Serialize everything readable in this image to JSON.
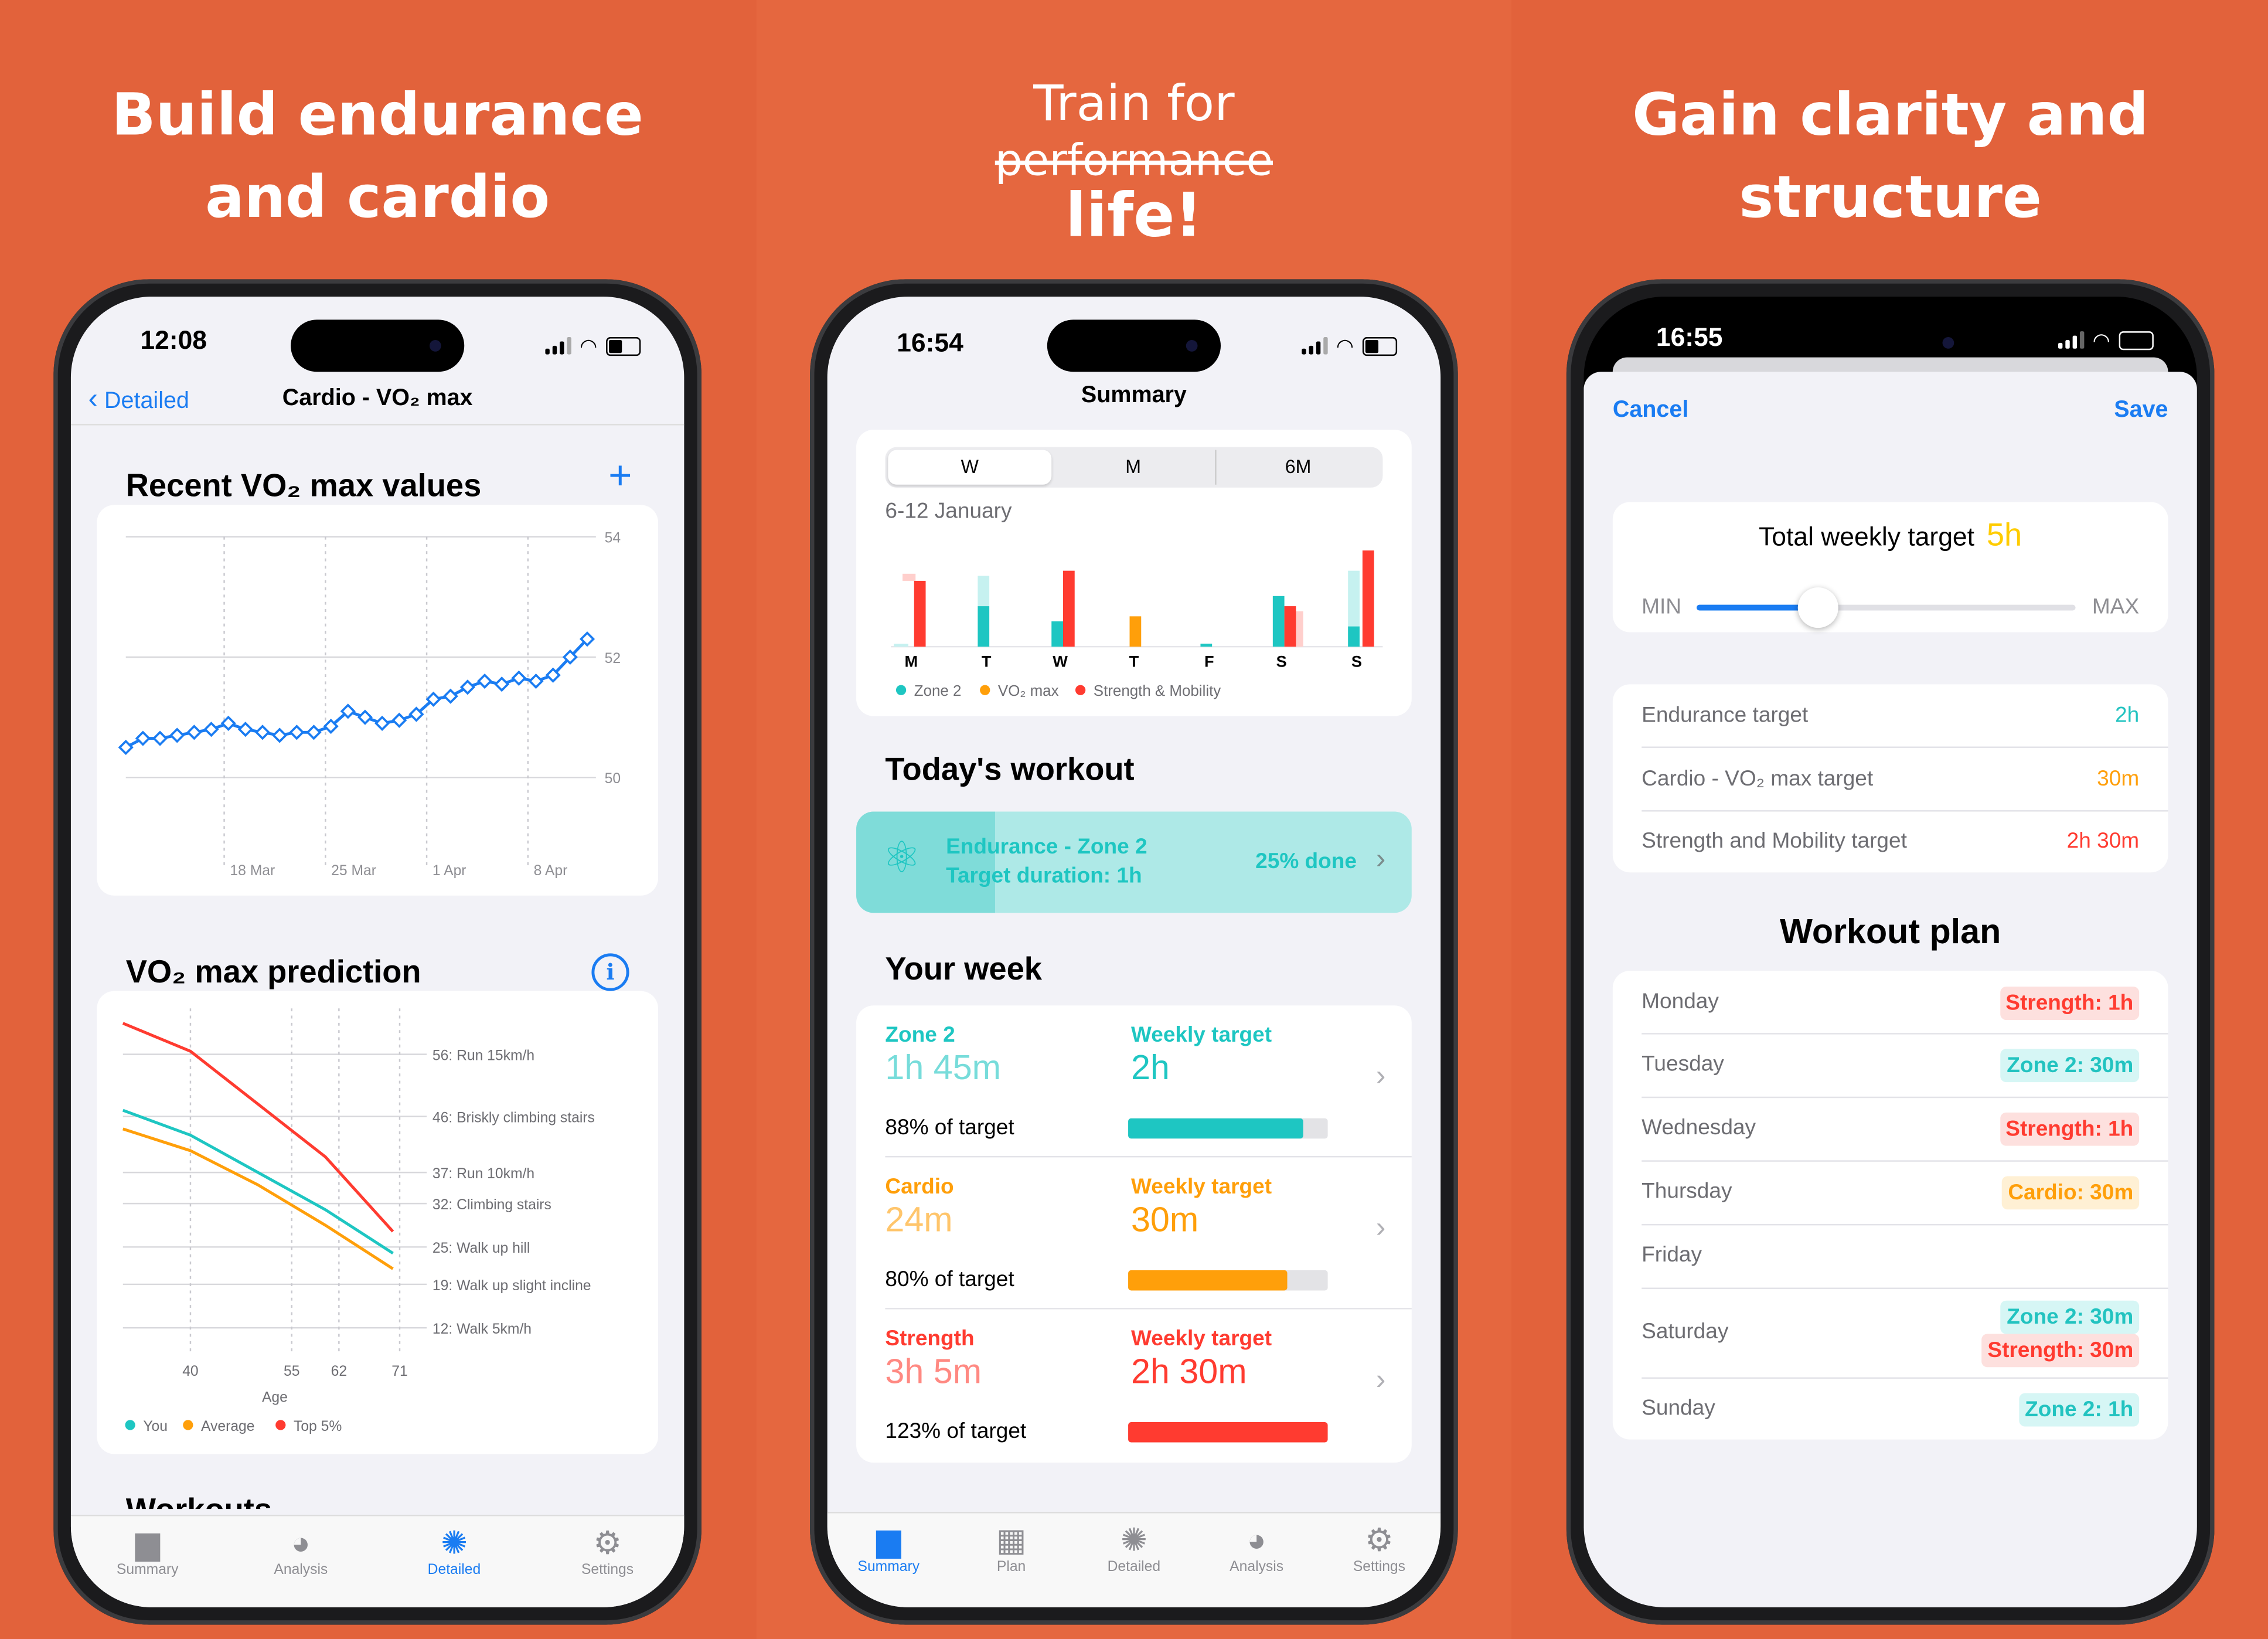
{
  "panel1": {
    "headline": [
      "Build endurance",
      "and cardio"
    ],
    "status": {
      "time": "12:08"
    },
    "nav": {
      "back": "Detailed",
      "title": "Cardio - VO₂ max"
    },
    "recent": {
      "title": "Recent VO₂ max values",
      "add": "+"
    },
    "prediction": {
      "title": "VO₂ max prediction",
      "info": "i"
    },
    "workouts_peek": "Workouts",
    "tabs": [
      "Summary",
      "Analysis",
      "Detailed",
      "Settings"
    ]
  },
  "panel2": {
    "headline": {
      "line1": "Train for",
      "struck": "performance",
      "line3": "life!"
    },
    "status": {
      "time": "16:54"
    },
    "nav_title": "Summary",
    "segments": [
      "W",
      "M",
      "6M"
    ],
    "date_range": "6-12 January",
    "todays_workout": {
      "title": "Today's workout",
      "name": "Endurance - Zone 2",
      "duration": "Target duration: 1h",
      "progress_label": "25% done",
      "progress": 0.25
    },
    "your_week": {
      "title": "Your week",
      "items": [
        {
          "name": "Zone 2",
          "value": "1h 45m",
          "target_label": "Weekly target",
          "target": "2h",
          "pct_label": "88% of target",
          "progress": 0.88,
          "color": "#1ec6c2"
        },
        {
          "name": "Cardio",
          "value": "24m",
          "target_label": "Weekly target",
          "target": "30m",
          "pct_label": "80% of target",
          "progress": 0.8,
          "color": "#ff9f0a"
        },
        {
          "name": "Strength",
          "value": "3h 5m",
          "target_label": "Weekly target",
          "target": "2h 30m",
          "pct_label": "123% of target",
          "progress": 1.0,
          "color": "#ff3b30"
        }
      ]
    },
    "tabs": [
      "Summary",
      "Plan",
      "Detailed",
      "Analysis",
      "Settings"
    ]
  },
  "panel3": {
    "headline": [
      "Gain clarity and",
      "structure"
    ],
    "status": {
      "time": "16:55"
    },
    "cancel": "Cancel",
    "save": "Save",
    "total_target": {
      "label": "Total weekly target",
      "value": "5h",
      "min": "MIN",
      "max": "MAX",
      "slider": 0.32
    },
    "targets": [
      {
        "label": "Endurance target",
        "value": "2h",
        "color": "teal"
      },
      {
        "label": "Cardio - VO₂ max target",
        "value": "30m",
        "color": "orange"
      },
      {
        "label": "Strength and Mobility target",
        "value": "2h 30m",
        "color": "red"
      }
    ],
    "plan_title": "Workout plan",
    "plan": [
      {
        "day": "Monday",
        "items": [
          {
            "text": "Strength: 1h",
            "color": "red"
          }
        ]
      },
      {
        "day": "Tuesday",
        "items": [
          {
            "text": "Zone 2: 30m",
            "color": "teal"
          }
        ]
      },
      {
        "day": "Wednesday",
        "items": [
          {
            "text": "Strength: 1h",
            "color": "red"
          }
        ]
      },
      {
        "day": "Thursday",
        "items": [
          {
            "text": "Cardio: 30m",
            "color": "orange"
          }
        ]
      },
      {
        "day": "Friday",
        "items": []
      },
      {
        "day": "Saturday",
        "items": [
          {
            "text": "Zone 2: 30m",
            "color": "teal"
          },
          {
            "text": "Strength: 30m",
            "color": "red"
          }
        ]
      },
      {
        "day": "Sunday",
        "items": [
          {
            "text": "Zone 2: 1h",
            "color": "teal"
          }
        ]
      }
    ]
  },
  "colors": {
    "background": "#e2623b",
    "accent_blue": "#1a7cf2",
    "zone2": "#1ec6c2",
    "vo2": "#ff9f0a",
    "strength": "#ff3b30"
  },
  "chart_data": [
    {
      "type": "line",
      "title": "Recent VO₂ max values",
      "x_tick_labels": [
        "18 Mar",
        "25 Mar",
        "1 Apr",
        "8 Apr"
      ],
      "y_ticks": [
        50,
        52,
        54
      ],
      "ylim": [
        49,
        54
      ],
      "series": [
        {
          "values": [
            50.5,
            50.65,
            50.65,
            50.7,
            50.75,
            50.8,
            50.9,
            50.8,
            50.75,
            50.7,
            50.75,
            50.75,
            50.85,
            51.1,
            51.0,
            50.9,
            50.95,
            51.05,
            51.3,
            51.35,
            51.5,
            51.6,
            51.55,
            51.65,
            51.6,
            51.7,
            52.0,
            52.3
          ]
        }
      ]
    },
    {
      "type": "line",
      "title": "VO₂ max prediction",
      "xlabel": "Age",
      "x_ticks": [
        40,
        55,
        62,
        71
      ],
      "xlim": [
        30,
        75
      ],
      "ylim": [
        8,
        62
      ],
      "reference_lines": [
        {
          "value": 56,
          "label": "56: Run 15km/h"
        },
        {
          "value": 46,
          "label": "46: Briskly climbing stairs"
        },
        {
          "value": 37,
          "label": "37: Run 10km/h"
        },
        {
          "value": 32,
          "label": "32: Climbing stairs"
        },
        {
          "value": 25,
          "label": "25: Walk up hill"
        },
        {
          "value": 19,
          "label": "19: Walk up slight incline"
        },
        {
          "value": 12,
          "label": "12: Walk 5km/h"
        }
      ],
      "series": [
        {
          "name": "You",
          "color": "#1ec6c2",
          "x": [
            30,
            40,
            50,
            60,
            70
          ],
          "y": [
            47,
            43,
            37,
            31,
            24
          ]
        },
        {
          "name": "Average",
          "color": "#ff9f0a",
          "x": [
            30,
            40,
            50,
            60,
            70
          ],
          "y": [
            44,
            40.5,
            35,
            28.5,
            21.5
          ]
        },
        {
          "name": "Top 5%",
          "color": "#ff3b30",
          "x": [
            30,
            40,
            50,
            60,
            70
          ],
          "y": [
            61,
            56.5,
            48,
            39.5,
            27.5
          ]
        }
      ]
    },
    {
      "type": "bar",
      "title": "6-12 January",
      "categories": [
        "M",
        "T",
        "W",
        "T",
        "F",
        "S",
        "S"
      ],
      "series": [
        {
          "name": "Zone 2",
          "color": "#1ec6c2",
          "values": [
            0.0,
            0.4,
            0.25,
            0,
            0.03,
            0.5,
            0.2
          ]
        },
        {
          "name": "VO₂ max",
          "color": "#ff9f0a",
          "values": [
            0,
            0,
            0,
            0.3,
            0,
            0,
            0
          ]
        },
        {
          "name": "Strength & Mobility",
          "color": "#ff3b30",
          "values": [
            0.65,
            0,
            0.75,
            0,
            0,
            0.4,
            0.95
          ]
        }
      ]
    }
  ]
}
